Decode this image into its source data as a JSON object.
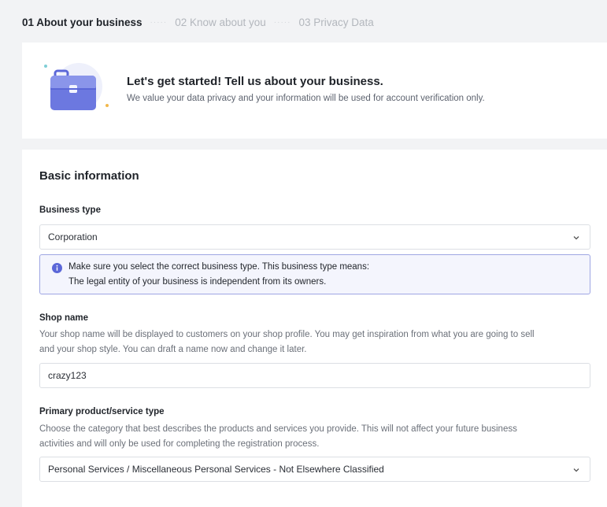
{
  "stepper": {
    "steps": [
      {
        "label": "01 About your business"
      },
      {
        "label": "02 Know about you"
      },
      {
        "label": "03 Privacy Data"
      }
    ]
  },
  "hero": {
    "icon": "briefcase-icon",
    "title": "Let's get started! Tell us about your business.",
    "subtitle": "We value your data privacy and your information will be used for account verification only."
  },
  "form": {
    "section_title": "Basic information",
    "business_type": {
      "label": "Business type",
      "value": "Corporation",
      "notice_line1": "Make sure you select the correct business type. This business type means:",
      "notice_line2": "The legal entity of your business is independent from its owners."
    },
    "shop_name": {
      "label": "Shop name",
      "desc_line1": "Your shop name will be displayed to customers on your shop profile. You may get inspiration from what you are going to sell",
      "desc_line2": "and your shop style. You can draft a name now and change it later.",
      "value": "crazy123"
    },
    "primary_type": {
      "label": "Primary product/service type",
      "desc_line1": "Choose the category that best describes the products and services you provide. This will not affect your future business",
      "desc_line2": "activities and will only be used for completing the registration process.",
      "value": "Personal Services / Miscellaneous Personal Services - Not Elsewhere Classified"
    }
  },
  "colors": {
    "accent": "#5b67d8",
    "notice_border": "#9ea6e3",
    "notice_bg": "#f4f5fd"
  }
}
